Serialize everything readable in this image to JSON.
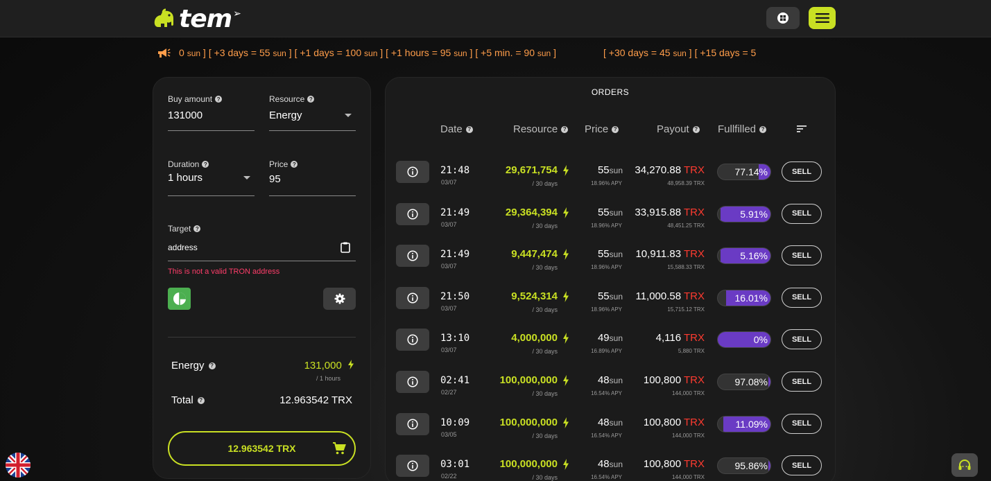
{
  "app": {
    "logo_text": "tem"
  },
  "ticker": {
    "items": [
      {
        "text": "0",
        "unit": "sun",
        "suffix": " ]"
      },
      {
        "text": "[ +3 days = 55",
        "unit": "sun",
        "suffix": " ]"
      },
      {
        "text": "[ +1 days = 100",
        "unit": "sun",
        "suffix": " ]"
      },
      {
        "text": "[ +1 hours = 95",
        "unit": "sun",
        "suffix": " ]"
      },
      {
        "text": "[ +5 min. = 90",
        "unit": "sun",
        "suffix": " ]"
      }
    ],
    "items_b": [
      {
        "text": "[ +30 days = 45",
        "unit": "sun",
        "suffix": " ]"
      },
      {
        "text": "[ +15 days = 5",
        "unit": "",
        "suffix": ""
      }
    ]
  },
  "form": {
    "buy_amount_label": "Buy amount",
    "buy_amount_value": "131000",
    "resource_label": "Resource",
    "resource_value": "Energy",
    "duration_label": "Duration",
    "duration_value": "1 hours",
    "price_label": "Price",
    "price_value": "95",
    "target_label": "Target",
    "target_placeholder": "address",
    "target_error": "This is not a valid TRON address"
  },
  "summary": {
    "energy_label": "Energy",
    "energy_value": "131,000",
    "energy_sub": "/ 1 hours",
    "total_label": "Total",
    "total_value": "12.963542 TRX",
    "buy_button": "12.963542 TRX"
  },
  "orders": {
    "title": "ORDERS",
    "headers": {
      "date": "Date",
      "resource": "Resource",
      "price": "Price",
      "payout": "Payout",
      "fulfilled": "Fullfilled"
    },
    "sell_label": "SELL",
    "rows": [
      {
        "time": "21:48",
        "date": "03/07",
        "resource": "29,671,754",
        "resource_sub": "/ 30 days",
        "price": "55",
        "price_unit": "sun",
        "apy": "18.96% APY",
        "payout": "34,270.88",
        "payout_unit": "TRX",
        "payout_sub": "48,958.39 TRX",
        "fulfilled": "77.14%",
        "fulfilled_pct": 77.14
      },
      {
        "time": "21:49",
        "date": "03/07",
        "resource": "29,364,394",
        "resource_sub": "/ 30 days",
        "price": "55",
        "price_unit": "sun",
        "apy": "18.96% APY",
        "payout": "33,915.88",
        "payout_unit": "TRX",
        "payout_sub": "48,451.25 TRX",
        "fulfilled": "5.91%",
        "fulfilled_pct": 5.91
      },
      {
        "time": "21:49",
        "date": "03/07",
        "resource": "9,447,474",
        "resource_sub": "/ 30 days",
        "price": "55",
        "price_unit": "sun",
        "apy": "18.96% APY",
        "payout": "10,911.83",
        "payout_unit": "TRX",
        "payout_sub": "15,588.33 TRX",
        "fulfilled": "5.16%",
        "fulfilled_pct": 5.16
      },
      {
        "time": "21:50",
        "date": "03/07",
        "resource": "9,524,314",
        "resource_sub": "/ 30 days",
        "price": "55",
        "price_unit": "sun",
        "apy": "18.96% APY",
        "payout": "11,000.58",
        "payout_unit": "TRX",
        "payout_sub": "15,715.12 TRX",
        "fulfilled": "16.01%",
        "fulfilled_pct": 16.01
      },
      {
        "time": "13:10",
        "date": "03/07",
        "resource": "4,000,000",
        "resource_sub": "/ 30 days",
        "price": "49",
        "price_unit": "sun",
        "apy": "16.89% APY",
        "payout": "4,116",
        "payout_unit": "TRX",
        "payout_sub": "5,880 TRX",
        "fulfilled": "0%",
        "fulfilled_pct": 0
      },
      {
        "time": "02:41",
        "date": "02/27",
        "resource": "100,000,000",
        "resource_sub": "/ 30 days",
        "price": "48",
        "price_unit": "sun",
        "apy": "16.54% APY",
        "payout": "100,800",
        "payout_unit": "TRX",
        "payout_sub": "144,000 TRX",
        "fulfilled": "97.08%",
        "fulfilled_pct": 97.08
      },
      {
        "time": "10:09",
        "date": "03/05",
        "resource": "100,000,000",
        "resource_sub": "/ 30 days",
        "price": "48",
        "price_unit": "sun",
        "apy": "16.54% APY",
        "payout": "100,800",
        "payout_unit": "TRX",
        "payout_sub": "144,000 TRX",
        "fulfilled": "11.09%",
        "fulfilled_pct": 11.09
      },
      {
        "time": "03:01",
        "date": "02/22",
        "resource": "100,000,000",
        "resource_sub": "/ 30 days",
        "price": "48",
        "price_unit": "sun",
        "apy": "16.54% APY",
        "payout": "100,800",
        "payout_unit": "TRX",
        "payout_sub": "144,000 TRX",
        "fulfilled": "95.86%",
        "fulfilled_pct": 95.86
      }
    ]
  },
  "colors": {
    "accent": "#c9e023",
    "ticker": "#ff9d4a",
    "trx": "#ff3b30",
    "fill": "#6a3bc4",
    "error": "#ff3d6a"
  },
  "icons": {
    "logo": "elephant-icon",
    "wallet": "wallet-icon",
    "menu": "hamburger-menu-icon",
    "megaphone": "megaphone-icon",
    "clipboard": "clipboard-icon",
    "pie": "pie-chart-icon",
    "gear": "gear-icon",
    "cart": "cart-icon",
    "info": "info-icon",
    "bolt": "bolt-icon",
    "sort": "sort-icon",
    "flag": "uk-flag-icon",
    "support": "headset-icon"
  }
}
